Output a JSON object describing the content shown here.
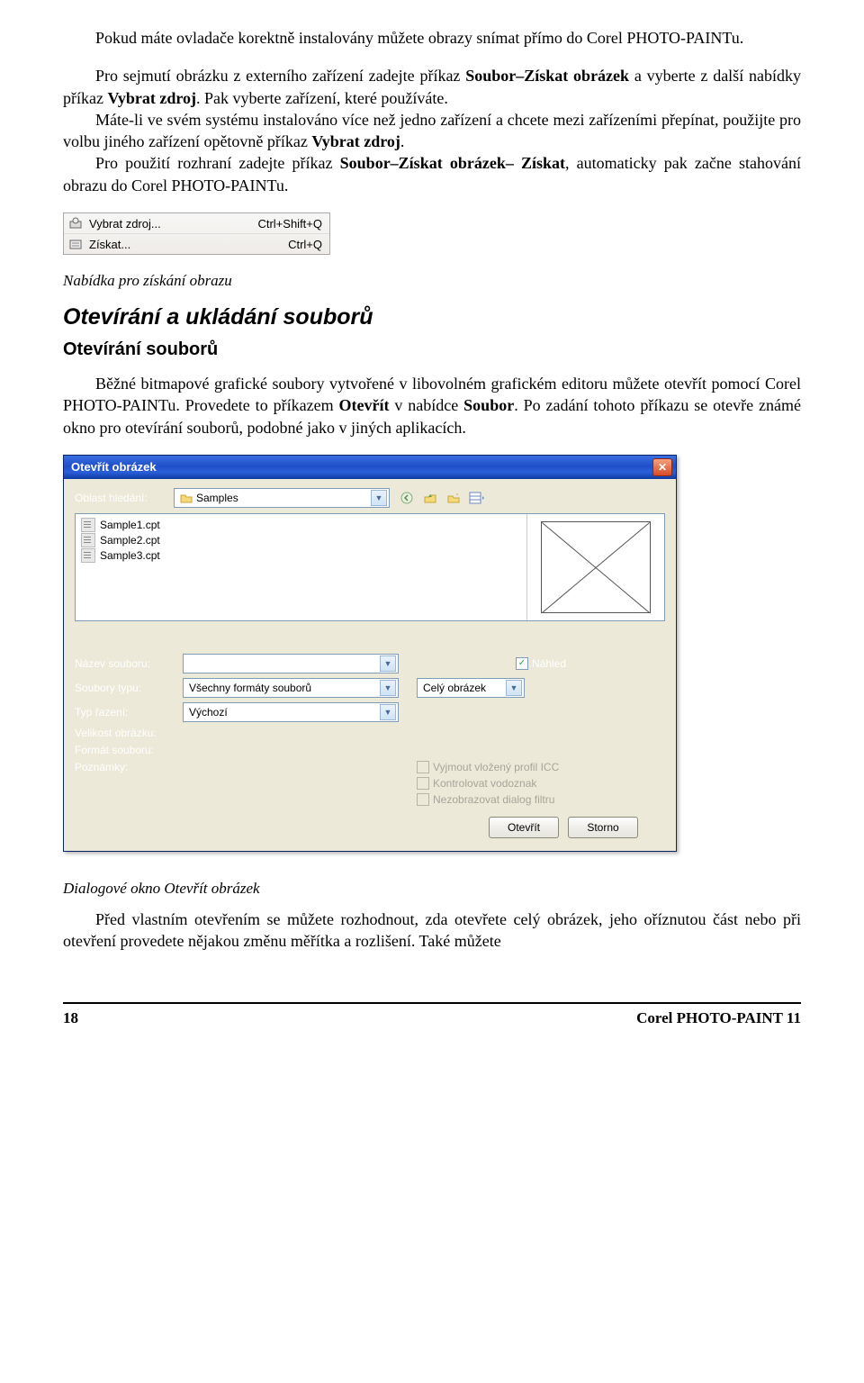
{
  "para1": "Pokud máte ovladače korektně instalovány můžete obrazy snímat přímo do Corel PHOTO-PAINTu.",
  "para2_a": "Pro sejmutí obrázku z externího zařízení zadejte příkaz ",
  "para2_b": "Soubor–Získat obrázek",
  "para2_c": " a vyberte z další nabídky příkaz ",
  "para2_d": "Vybrat zdroj",
  "para2_e": ". Pak vyberte zařízení, které používáte.",
  "para3_a": "Máte-li ve svém systému instalováno více než jedno zařízení a chcete mezi zařízeními přepínat, použijte pro volbu jiného zařízení opětovně příkaz ",
  "para3_b": "Vybrat zdroj",
  "para3_c": ".",
  "para4_a": "Pro použití rozhraní zadejte příkaz ",
  "para4_b": "Soubor–Získat obrázek– Získat",
  "para4_c": ", automaticky pak začne stahování obrazu do Corel PHOTO-PAINTu.",
  "menu": {
    "item1": {
      "label": "Vybrat zdroj...",
      "shortcut": "Ctrl+Shift+Q"
    },
    "item2": {
      "label": "Získat...",
      "shortcut": "Ctrl+Q"
    }
  },
  "caption1": "Nabídka pro získání obrazu",
  "h2": "Otevírání a ukládání souborů",
  "h3": "Otevírání souborů",
  "para5_a": "Běžné bitmapové grafické soubory vytvořené v libovolném grafickém editoru můžete otevřít pomocí Corel PHOTO-PAINTu. Provedete to příkazem ",
  "para5_b": "Otevřít",
  "para5_c": " v nabídce ",
  "para5_d": "Soubor",
  "para5_e": ". Po zadání tohoto příkazu se otevře známé okno pro otevírání souborů, podobné jako v jiných aplikacích.",
  "dialog": {
    "title": "Otevřít obrázek",
    "lookin_label": "Oblast hledání:",
    "lookin_value": "Samples",
    "files": [
      "Sample1.cpt",
      "Sample2.cpt",
      "Sample3.cpt"
    ],
    "filename_label": "Název souboru:",
    "filename_value": "",
    "type_label": "Soubory typu:",
    "type_value": "Všechny formáty souborů",
    "sort_label": "Typ řazení:",
    "sort_value": "Výchozí",
    "full_value": "Celý obrázek",
    "preview_chk": "Náhled",
    "size_label": "Velikost obrázku:",
    "format_label": "Formát souboru:",
    "notes_label": "Poznámky:",
    "icc_chk": "Vyjmout vložený profil ICC",
    "water_chk": "Kontrolovat vodoznak",
    "filter_chk": "Nezobrazovat dialog filtru",
    "open_btn": "Otevřít",
    "cancel_btn": "Storno"
  },
  "caption2": "Dialogové okno Otevřít obrázek",
  "para6": "Před vlastním otevřením se můžete rozhodnout, zda otevřete celý obrázek, jeho oříznutou část nebo při otevření provedete nějakou změnu měřítka a rozlišení. Také můžete",
  "footer": {
    "page": "18",
    "product": "Corel PHOTO-PAINT 11"
  }
}
